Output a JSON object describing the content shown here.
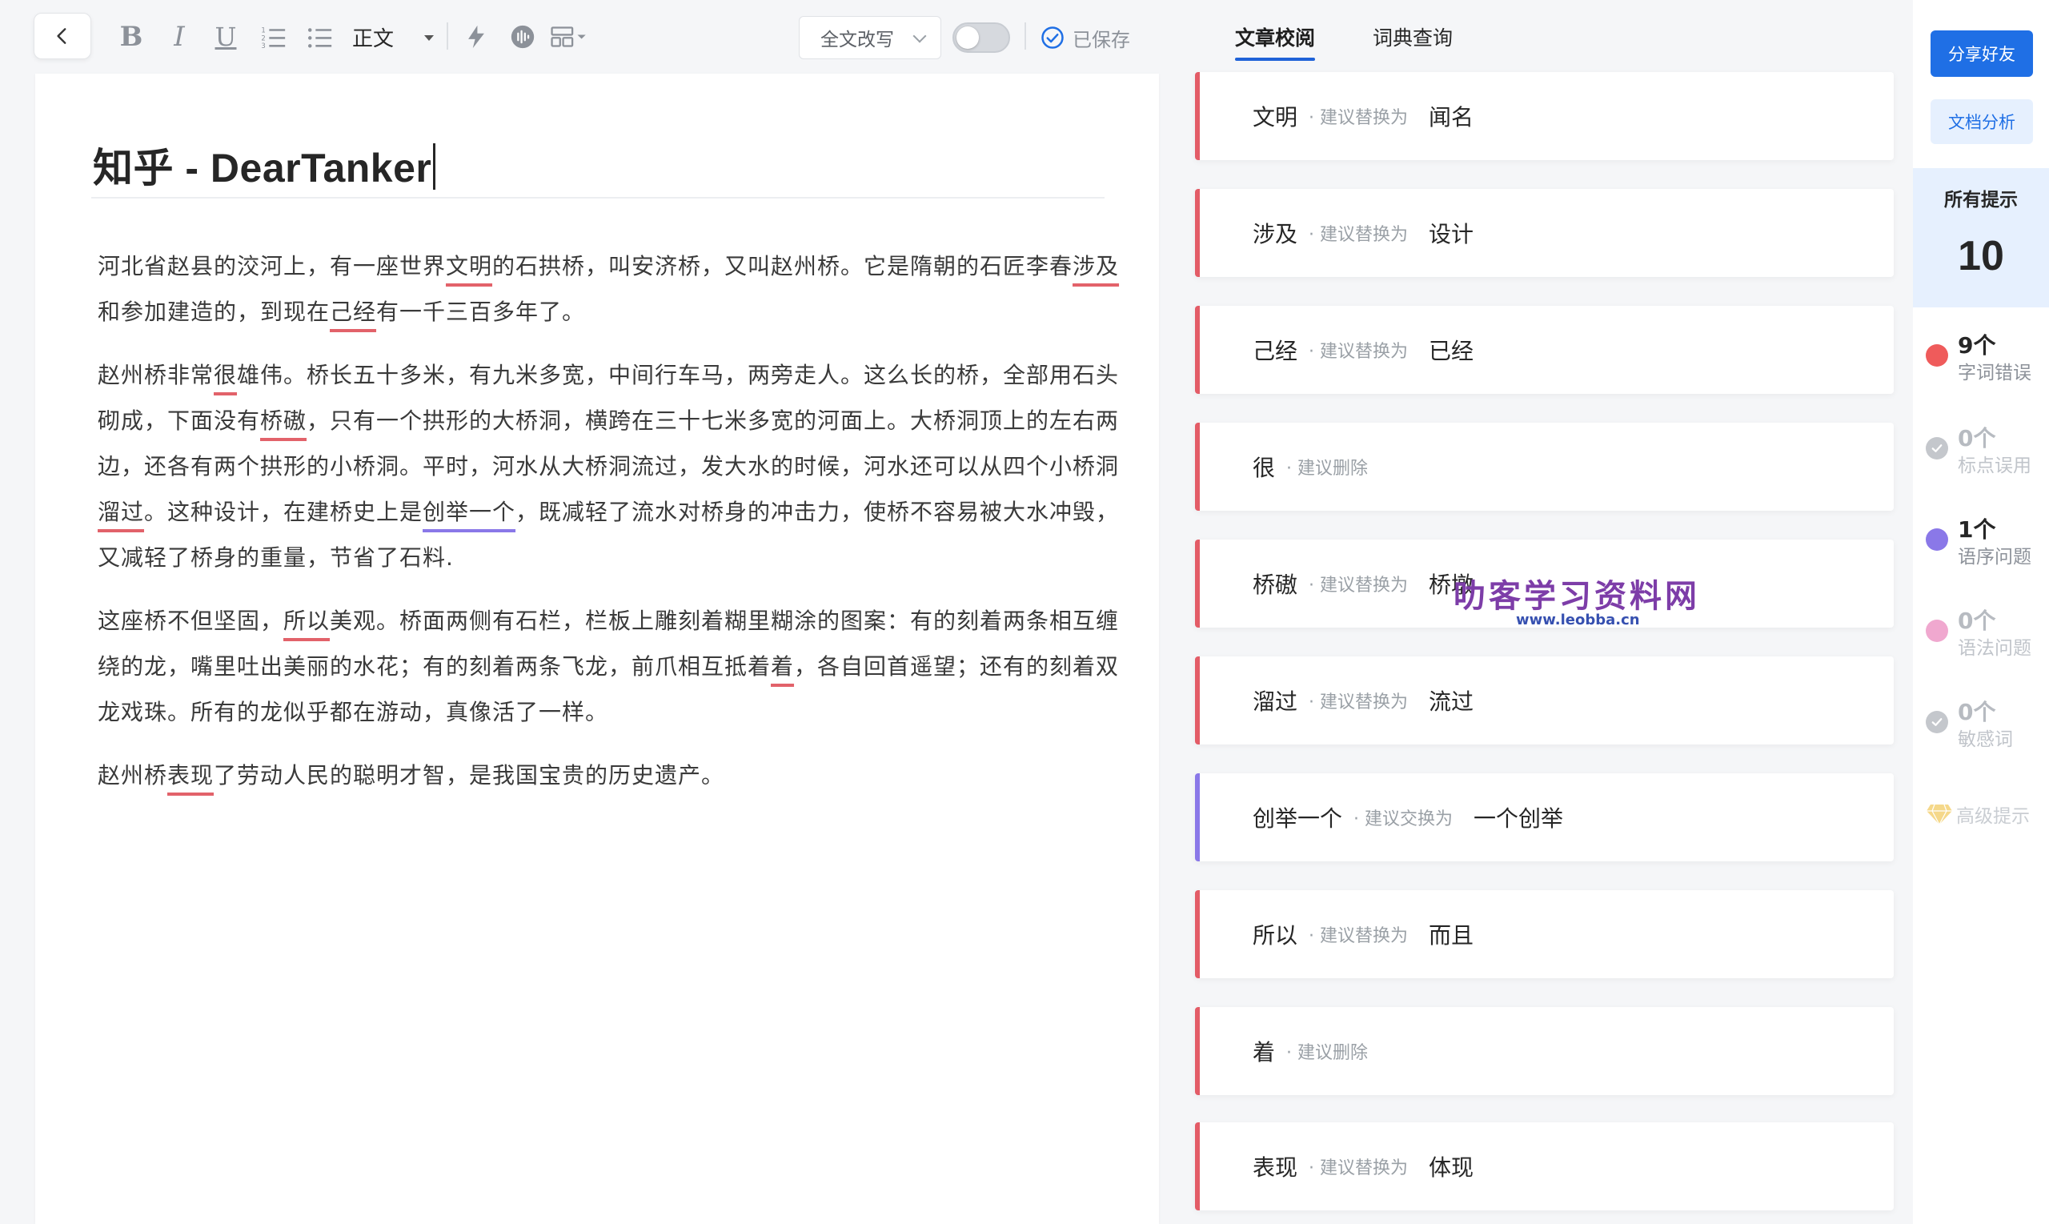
{
  "toolbar": {
    "bold_label": "B",
    "italic_label": "I",
    "underline_label": "U",
    "style_select": "正文",
    "rewrite_label": "全文改写",
    "saved_label": "已保存"
  },
  "tabs": [
    {
      "label": "文章校阅",
      "active": true
    },
    {
      "label": "词典查询",
      "active": false
    }
  ],
  "document": {
    "title": "知乎 - DearTanker",
    "paragraphs": [
      [
        {
          "t": "河北省赵县的洨河上，有一座世界"
        },
        {
          "t": "文明",
          "m": "red"
        },
        {
          "t": "的石拱桥，叫安济桥，又叫赵州桥。它是隋朝的石匠李春"
        },
        {
          "t": "涉及",
          "m": "red"
        },
        {
          "t": "和参加建造的，到现在"
        },
        {
          "t": "己经",
          "m": "red"
        },
        {
          "t": "有一千三百多年了。"
        }
      ],
      [
        {
          "t": "赵州桥非常"
        },
        {
          "t": "很",
          "m": "red"
        },
        {
          "t": "雄伟。桥长五十多米，有九米多宽，中间行车马，两旁走人。这么长的桥，全部用石头砌成，下面没有"
        },
        {
          "t": "桥磝",
          "m": "red"
        },
        {
          "t": "，只有一个拱形的大桥洞，横跨在三十七米多宽的河面上。大桥洞顶上的左右两边，还各有两个拱形的小桥洞。平时，河水从大桥洞流过，发大水的时候，河水还可以从四个小桥洞"
        },
        {
          "t": "溜过",
          "m": "red"
        },
        {
          "t": "。这种设计，在建桥史上是"
        },
        {
          "t": "创举一个",
          "m": "purple"
        },
        {
          "t": "，既减轻了流水对桥身的冲击力，使桥不容易被大水冲毁，又减轻了桥身的重量，节省了石料."
        }
      ],
      [
        {
          "t": "这座桥不但坚固，"
        },
        {
          "t": "所以",
          "m": "red"
        },
        {
          "t": "美观。桥面两侧有石栏，栏板上雕刻着糊里糊涂的图案：有的刻着两条相互缠绕的龙，嘴里吐出美丽的水花；有的刻着两条飞龙，前爪相互抵着"
        },
        {
          "t": "着",
          "m": "red"
        },
        {
          "t": "，各自回首遥望；还有的刻着双龙戏珠。所有的龙似乎都在游动，真像活了一样。"
        }
      ],
      [
        {
          "t": "赵州桥"
        },
        {
          "t": "表现",
          "m": "red"
        },
        {
          "t": "了劳动人民的聪明才智，是我国宝贵的历史遗产。"
        }
      ]
    ]
  },
  "suggestions": [
    {
      "orig": "文明",
      "hint": "· 建议替换为",
      "sugg": "闻名",
      "color": "#e35c67"
    },
    {
      "orig": "涉及",
      "hint": "· 建议替换为",
      "sugg": "设计",
      "color": "#e35c67"
    },
    {
      "orig": "己经",
      "hint": "· 建议替换为",
      "sugg": "已经",
      "color": "#e35c67"
    },
    {
      "orig": "很",
      "hint": "· 建议删除",
      "sugg": "",
      "color": "#e35c67"
    },
    {
      "orig": "桥磝",
      "hint": "· 建议替换为",
      "sugg": "桥墩",
      "color": "#e35c67"
    },
    {
      "orig": "溜过",
      "hint": "· 建议替换为",
      "sugg": "流过",
      "color": "#e35c67"
    },
    {
      "orig": "创举一个",
      "hint": "· 建议交换为",
      "sugg": "一个创举",
      "color": "#8a78e8"
    },
    {
      "orig": "所以",
      "hint": "· 建议替换为",
      "sugg": "而且",
      "color": "#e35c67"
    },
    {
      "orig": "着",
      "hint": "· 建议删除",
      "sugg": "",
      "color": "#e35c67"
    },
    {
      "orig": "表现",
      "hint": "· 建议替换为",
      "sugg": "体现",
      "color": "#e35c67"
    }
  ],
  "watermark": {
    "main": "叻客学习资料网",
    "url": "www.leobba.cn"
  },
  "sidebar": {
    "share_label": "分享好友",
    "analysis_label": "文档分析",
    "total_label": "所有提示",
    "total_count": "10",
    "stats": [
      {
        "count": "9个",
        "label": "字词错误",
        "color": "#ef5b5b",
        "active": true
      },
      {
        "count": "0个",
        "label": "标点误用",
        "color": "#c4c7cc",
        "active": false
      },
      {
        "count": "1个",
        "label": "语序问题",
        "color": "#8a78e8",
        "active": true
      },
      {
        "count": "0个",
        "label": "语法问题",
        "color": "#f0a8cf",
        "active": false
      },
      {
        "count": "0个",
        "label": "敏感词",
        "color": "#c4c7cc",
        "active": false
      }
    ],
    "advanced_label": "高级提示"
  }
}
